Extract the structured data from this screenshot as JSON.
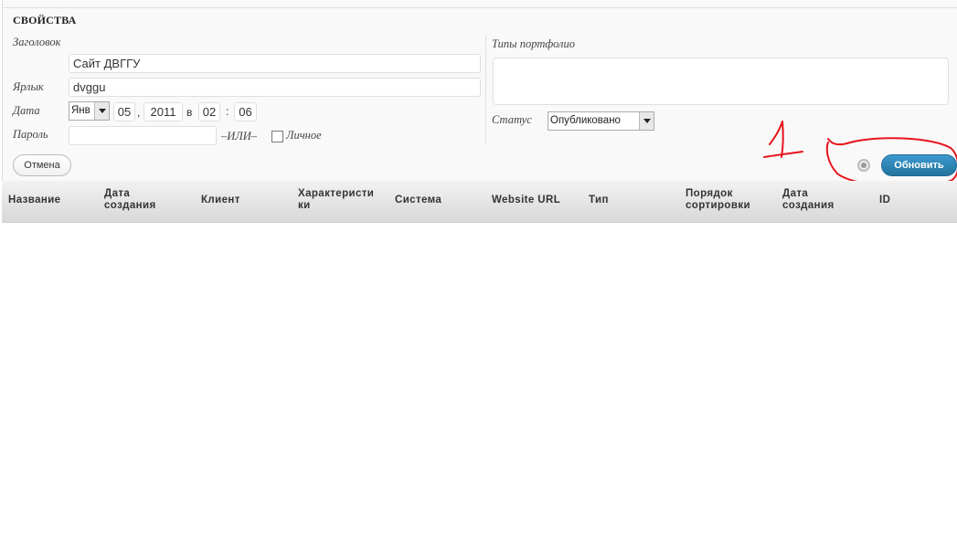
{
  "panel": {
    "title": "СВОЙСТВА",
    "fields": {
      "title_label": "Заголовок",
      "title_value": "Сайт ДВГГУ",
      "slug_label": "Ярлык",
      "slug_value": "dvggu",
      "date_label": "Дата",
      "month": "Янв",
      "day": "05",
      "comma": ",",
      "year": "2011",
      "at": "в",
      "hour": "02",
      "colon": ":",
      "minute": "06",
      "password_label": "Пароль",
      "password_value": "",
      "or_text": "–ИЛИ–",
      "private_label": "Личное",
      "private_checked": false
    },
    "right": {
      "portfolio_types_label": "Типы портфолио",
      "portfolio_types_value": "",
      "status_label": "Статус",
      "status_value": "Опубликовано"
    },
    "buttons": {
      "cancel": "Отмена",
      "update": "Обновить"
    }
  },
  "annotation": {
    "text": "1",
    "color": "#e8141c",
    "shape": "hand-drawn ellipse around update button"
  },
  "table": {
    "columns": [
      {
        "line1": "Название",
        "line2": ""
      },
      {
        "line1": "Дата",
        "line2": "создания"
      },
      {
        "line1": "Клиент",
        "line2": ""
      },
      {
        "line1": "Характеристи",
        "line2": "ки"
      },
      {
        "line1": "Система",
        "line2": ""
      },
      {
        "line1": "Website URL",
        "line2": ""
      },
      {
        "line1": "Тип",
        "line2": ""
      },
      {
        "line1": "Порядок",
        "line2": "сортировки"
      },
      {
        "line1": "Дата",
        "line2": "создания"
      },
      {
        "line1": "ID",
        "line2": ""
      }
    ]
  },
  "colors": {
    "panel_bg": "#f9f9f9",
    "primary_button": "#21759b",
    "header_gradient_top": "#f2f2f2",
    "header_gradient_bottom": "#d8d8d8"
  }
}
